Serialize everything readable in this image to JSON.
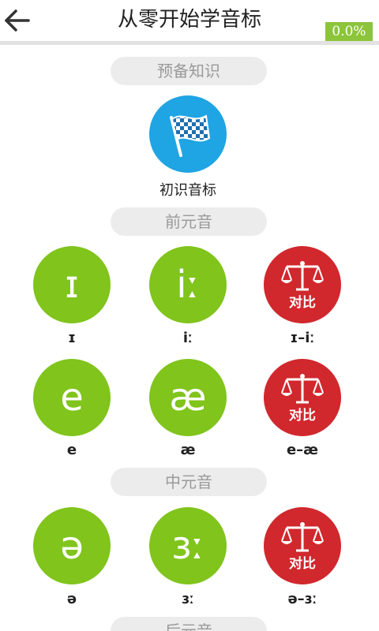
{
  "header": {
    "title": "从零开始学音标",
    "progress": "0.0%"
  },
  "sections": [
    {
      "title": "预备知识"
    },
    {
      "title": "前元音"
    },
    {
      "title": "中元音"
    },
    {
      "title": "后元音"
    }
  ],
  "intro": {
    "label": "初识音标",
    "icon": "checkered-flag-icon"
  },
  "colors": {
    "green": "#80c41c",
    "red": "#d0282d",
    "blue": "#1fa4e4",
    "progress": "#8cc43a"
  },
  "compare_label": "对比",
  "front_vowels": [
    {
      "symbol": "ɪ",
      "caption": "ɪ"
    },
    {
      "symbol": "iː",
      "caption": "iː"
    },
    {
      "caption": "ɪ–iː"
    },
    {
      "symbol": "e",
      "caption": "e"
    },
    {
      "symbol": "æ",
      "caption": "æ"
    },
    {
      "caption": "e–æ"
    }
  ],
  "central_vowels": [
    {
      "symbol": "ə",
      "caption": "ə"
    },
    {
      "symbol": "ɜː",
      "caption": "ɜː"
    },
    {
      "caption": "ə–ɜː"
    }
  ]
}
